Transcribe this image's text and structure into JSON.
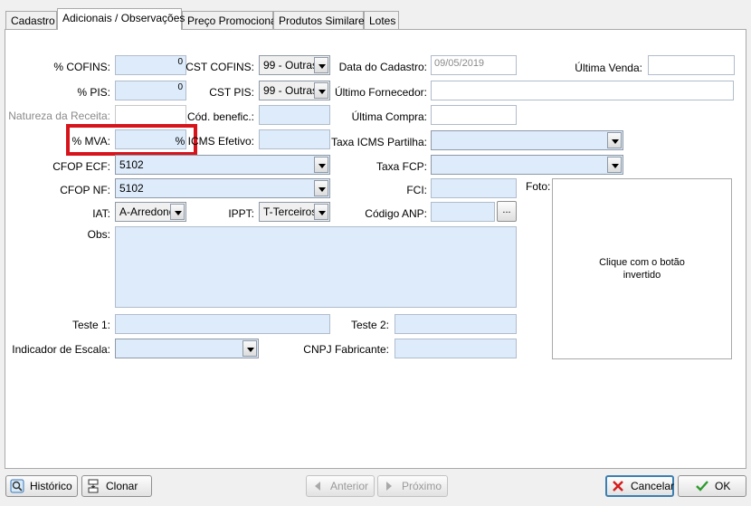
{
  "tabs": [
    {
      "label": "Cadastro"
    },
    {
      "label": "Adicionais / Observações"
    },
    {
      "label": "Preço Promocional"
    },
    {
      "label": "Produtos Similares"
    },
    {
      "label": "Lotes"
    }
  ],
  "form": {
    "cofins_label": "% COFINS:",
    "cofins_value": "0",
    "pis_label": "% PIS:",
    "pis_value": "0",
    "natureza_label": "Natureza da Receita:",
    "mva_label": "% MVA:",
    "cfop_ecf_label": "CFOP ECF:",
    "cfop_ecf_value": "5102",
    "cfop_nf_label": "CFOP NF:",
    "cfop_nf_value": "5102",
    "iat_label": "IAT:",
    "iat_value": "A-Arredonda",
    "obs_label": "Obs:",
    "cst_cofins_label": "CST COFINS:",
    "cst_cofins_value": "99 - Outras",
    "cst_pis_label": "CST PIS:",
    "cst_pis_value": "99 - Outras",
    "cod_benefic_label": "Cód. benefic.:",
    "icms_efetivo_label": "% ICMS Efetivo:",
    "ippt_label": "IPPT:",
    "ippt_value": "T-Terceiros",
    "data_cadastro_label": "Data do Cadastro:",
    "data_cadastro_value": "09/05/2019",
    "ultimo_fornecedor_label": "Último Fornecedor:",
    "ultima_compra_label": "Última Compra:",
    "taxa_icms_partilha_label": "Taxa ICMS Partilha:",
    "taxa_fcp_label": "Taxa FCP:",
    "fci_label": "FCI:",
    "codigo_anp_label": "Código ANP:",
    "codigo_anp_button": "...",
    "ultima_venda_label": "Última Venda:",
    "foto_label": "Foto:",
    "foto_hint": "Clique com o botão invertido",
    "teste1_label": "Teste 1:",
    "teste2_label": "Teste 2:",
    "indicador_escala_label": "Indicador de Escala:",
    "cnpj_fabricante_label": "CNPJ Fabricante:"
  },
  "buttons": {
    "historico": "Histórico",
    "clonar": "Clonar",
    "anterior": "Anterior",
    "proximo": "Próximo",
    "cancelar": "Cancelar",
    "ok": "OK"
  },
  "colors": {
    "field_bg": "#ddebfb",
    "highlight": "#d7141c"
  }
}
